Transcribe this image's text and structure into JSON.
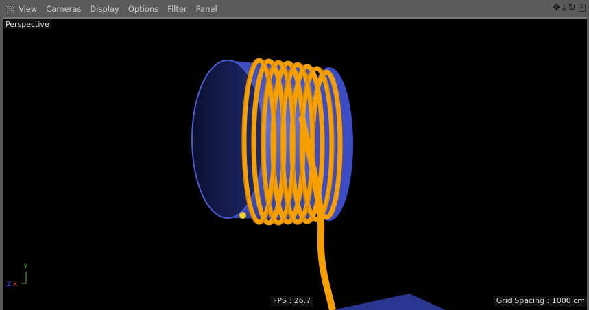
{
  "menu": {
    "items": [
      "View",
      "Cameras",
      "Display",
      "Options",
      "Filter",
      "Panel"
    ]
  },
  "nav_icons": [
    "move-icon",
    "zoom-icon",
    "rotate-icon",
    "layout-icon"
  ],
  "viewport": {
    "camera": "Perspective",
    "fps": "FPS : 26.7",
    "grid_spacing": "Grid Spacing : 1000 cm",
    "axes": {
      "y": "Y",
      "z": "Z",
      "x": "X"
    }
  },
  "colors": {
    "cylinder": "#4a5bd0",
    "coil": "#f5a000",
    "background": "#000000"
  }
}
